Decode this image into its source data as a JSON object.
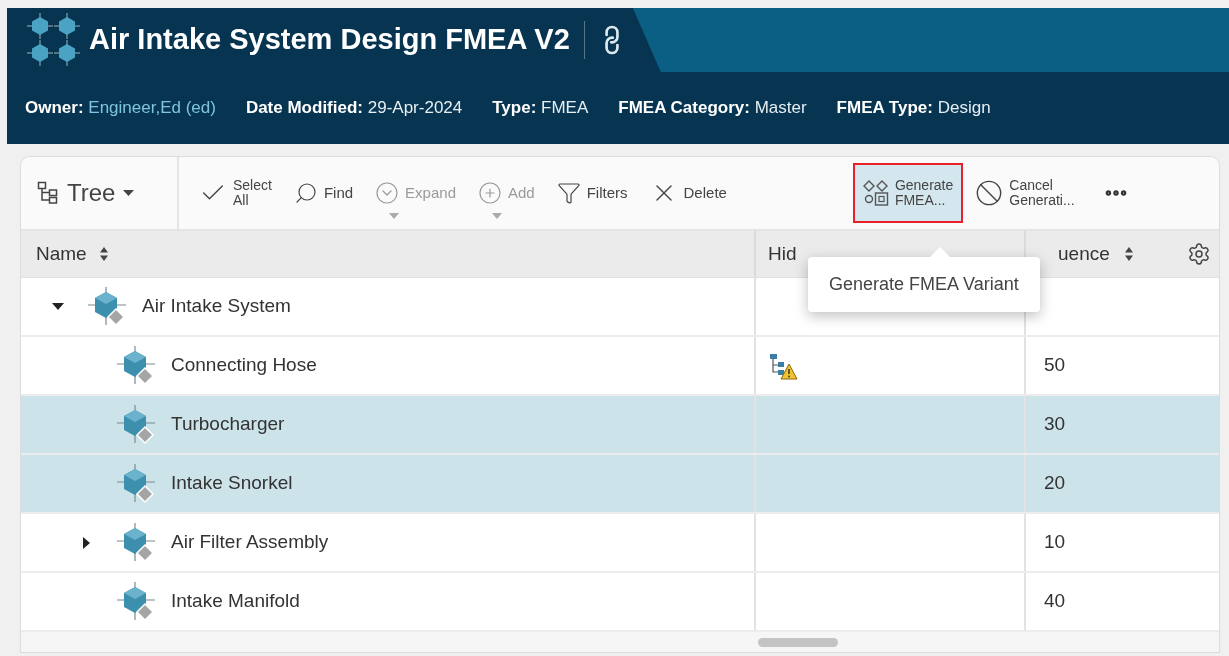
{
  "header": {
    "title": "Air Intake System Design FMEA V2",
    "metadata": [
      {
        "label": "Owner:",
        "value": "Engineer,Ed (ed)",
        "kind": "link"
      },
      {
        "label": "Date Modified:",
        "value": "29-Apr-2024",
        "kind": "text"
      },
      {
        "label": "Type:",
        "value": "FMEA",
        "kind": "text"
      },
      {
        "label": "FMEA Category:",
        "value": "Master",
        "kind": "text"
      },
      {
        "label": "FMEA Type:",
        "value": "Design",
        "kind": "text"
      }
    ]
  },
  "toolbar": {
    "view_menu": {
      "label": "Tree"
    },
    "buttons": [
      {
        "kind": "select",
        "lines": [
          "Select",
          "All"
        ],
        "disabled": false,
        "selected": false,
        "has_menu": false
      },
      {
        "kind": "find",
        "lines": [
          "Find"
        ],
        "disabled": false,
        "selected": false,
        "has_menu": false
      },
      {
        "kind": "expand",
        "lines": [
          "Expand"
        ],
        "disabled": true,
        "selected": false,
        "has_menu": true
      },
      {
        "kind": "add",
        "lines": [
          "Add"
        ],
        "disabled": true,
        "selected": false,
        "has_menu": true
      },
      {
        "kind": "filters",
        "lines": [
          "Filters"
        ],
        "disabled": false,
        "selected": false,
        "has_menu": false
      },
      {
        "kind": "delete",
        "lines": [
          "Delete"
        ],
        "disabled": false,
        "selected": false,
        "has_menu": false
      },
      {
        "kind": "generate",
        "lines": [
          "Generate",
          "FMEA..."
        ],
        "disabled": false,
        "selected": true,
        "has_menu": false
      },
      {
        "kind": "cancel",
        "lines": [
          "Cancel",
          "Generati..."
        ],
        "disabled": false,
        "selected": false,
        "has_menu": false
      }
    ]
  },
  "tooltip": "Generate FMEA Variant",
  "table": {
    "columns": [
      "Name",
      "Hid",
      "uence"
    ],
    "rows": [
      {
        "name": "Air Intake System",
        "expandable": true,
        "expanded": true,
        "selected": false,
        "hidden_children_warning": false,
        "children": [
          {
            "name": "Connecting Hose",
            "expandable": false,
            "selected": false,
            "hidden_children_warning": true,
            "sequence": "50"
          },
          {
            "name": "Turbocharger",
            "expandable": false,
            "selected": true,
            "hidden_children_warning": false,
            "sequence": "30"
          },
          {
            "name": "Intake Snorkel",
            "expandable": false,
            "selected": true,
            "hidden_children_warning": false,
            "sequence": "20"
          },
          {
            "name": "Air Filter Assembly",
            "expandable": true,
            "expanded": false,
            "selected": false,
            "hidden_children_warning": false,
            "sequence": "10"
          },
          {
            "name": "Intake Manifold",
            "expandable": false,
            "selected": false,
            "hidden_children_warning": false,
            "sequence": "40"
          }
        ]
      }
    ]
  }
}
